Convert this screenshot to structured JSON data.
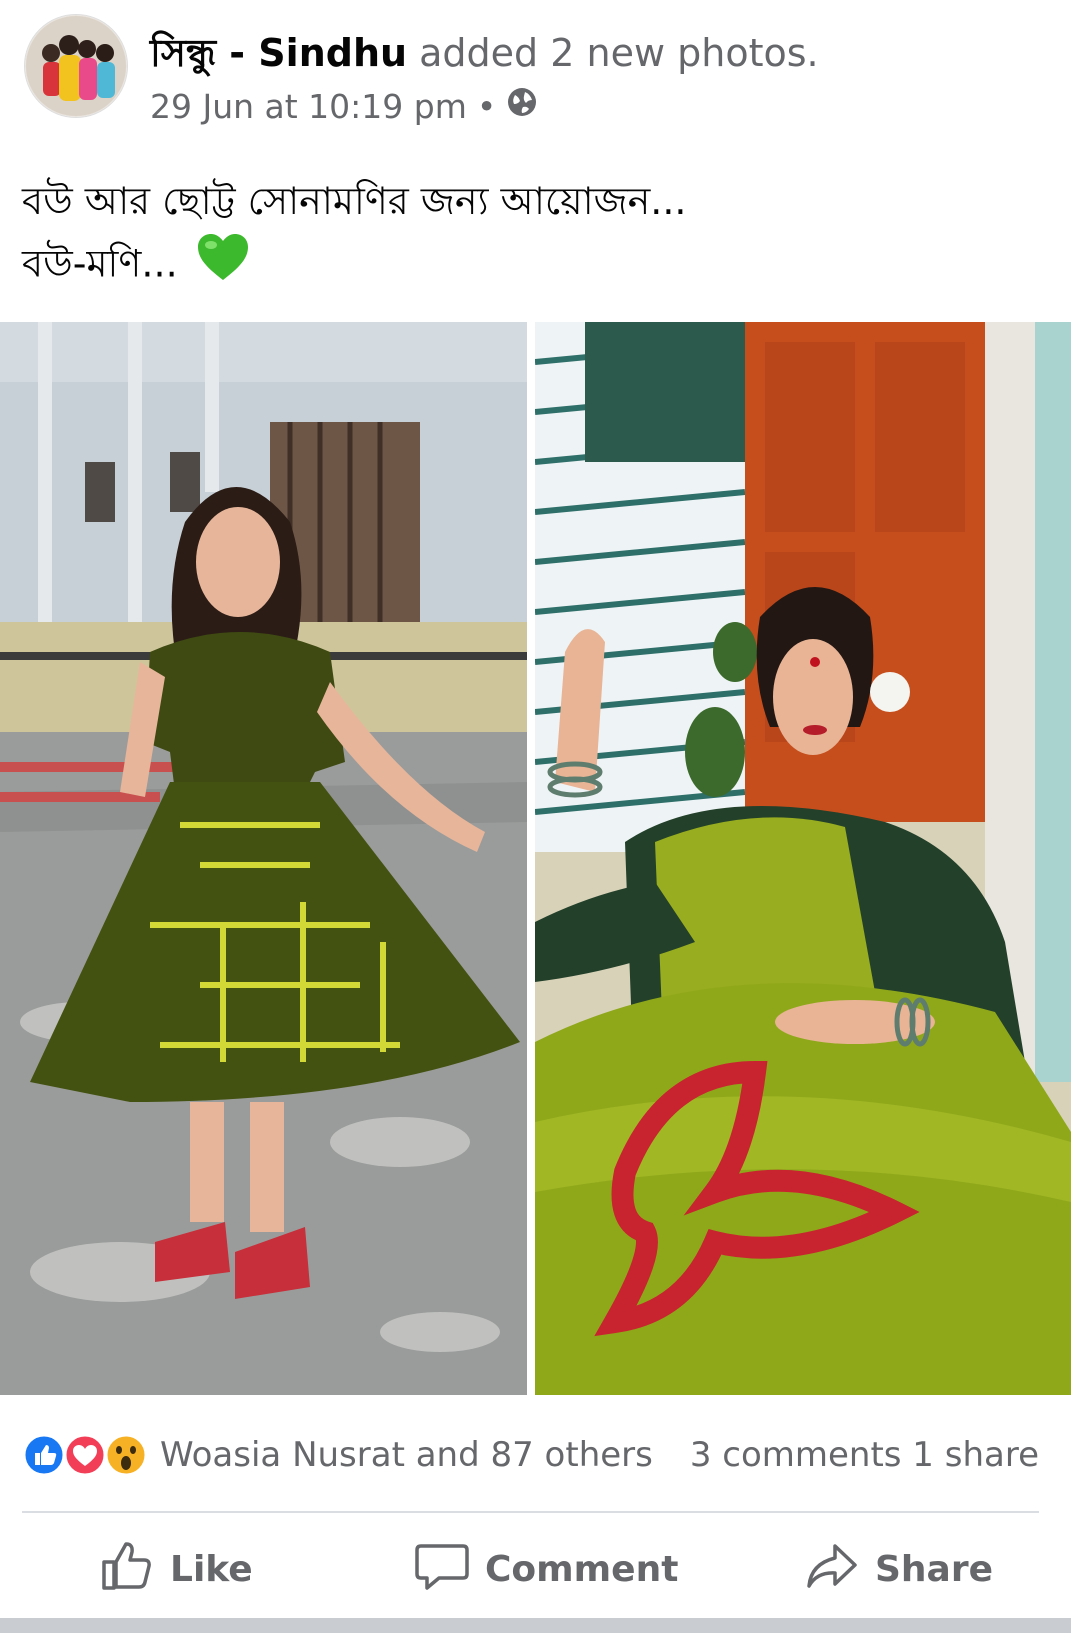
{
  "post": {
    "author_name": "সিন্ধু - Sindhu",
    "action_text": " added 2 new photos.",
    "timestamp": "29 Jun at 10:19 pm",
    "separator": "•",
    "privacy_icon": "globe-icon",
    "caption_line1": "বউ আর ছোট্ট সোনামণির জন্য আয়োজন...",
    "caption_line2": "বউ-মণি...",
    "caption_emoji": "green-heart-icon",
    "photos": [
      {
        "name": "photo-girl-green-dress"
      },
      {
        "name": "photo-woman-green-saree"
      }
    ]
  },
  "reactions": {
    "icons": [
      "like-reaction-icon",
      "love-reaction-icon",
      "wow-reaction-icon"
    ],
    "names_text": "Woasia Nusrat and 87 others",
    "counts_text": "3 comments 1 share"
  },
  "actions": {
    "like_label": "Like",
    "comment_label": "Comment",
    "share_label": "Share"
  },
  "colors": {
    "secondary_text": "#65676b",
    "like_blue": "#1877f2",
    "love_red": "#f33e58",
    "wow_yellow": "#f7b125",
    "heart_green": "#3cb92c"
  }
}
